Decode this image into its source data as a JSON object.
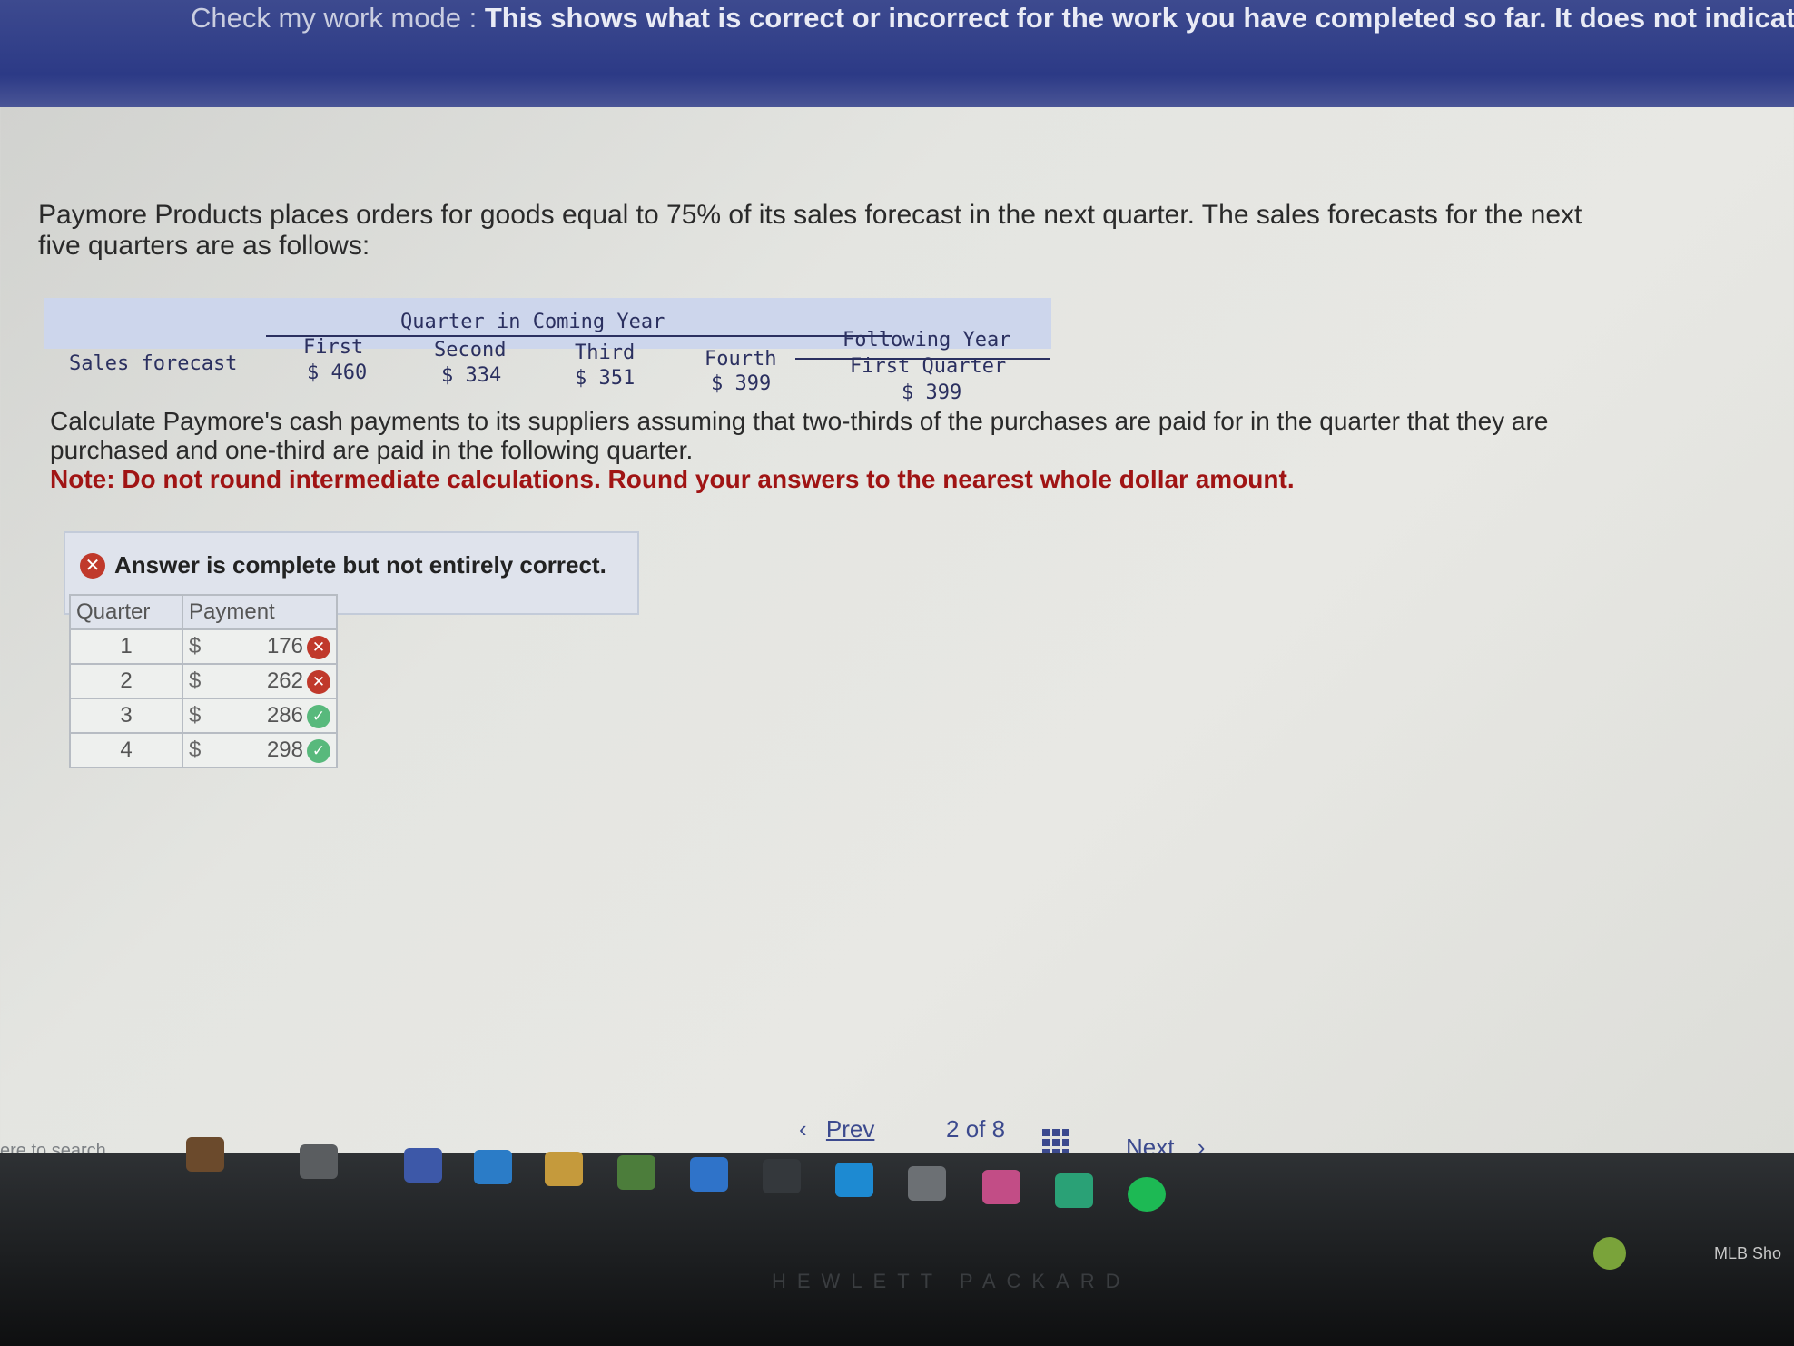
{
  "banner": {
    "lead": "Check my work mode : ",
    "text": "This shows what is correct or incorrect for the work you have completed so far. It does not indicate com"
  },
  "intro": "Paymore Products places orders for goods equal to 75% of its sales forecast in the next quarter. The sales forecasts for the next five quarters are as follows:",
  "forecast_table": {
    "group_coming": "Quarter in Coming Year",
    "group_following": "Following Year",
    "row_label": "Sales forecast",
    "columns": [
      {
        "header": "First",
        "value": "$ 460"
      },
      {
        "header": "Second",
        "value": "$ 334"
      },
      {
        "header": "Third",
        "value": "$ 351"
      },
      {
        "header": "Fourth",
        "value": "$ 399"
      },
      {
        "header": "First Quarter",
        "value": "$ 399"
      }
    ]
  },
  "question": "Calculate Paymore's cash payments to its suppliers assuming that two-thirds of the purchases are paid for in the quarter that they are purchased and one-third are paid in the following quarter.",
  "note": "Note: Do not round intermediate calculations. Round your answers to the nearest whole dollar amount.",
  "result": {
    "message": "Answer is complete but not entirely correct.",
    "status_icon": "x-circle-icon",
    "color": "#c0392b"
  },
  "answer_table": {
    "headers": [
      "Quarter",
      "Payment"
    ],
    "currency": "$",
    "rows": [
      {
        "quarter": "1",
        "payment": "176",
        "correct": false
      },
      {
        "quarter": "2",
        "payment": "262",
        "correct": false
      },
      {
        "quarter": "3",
        "payment": "286",
        "correct": true
      },
      {
        "quarter": "4",
        "payment": "298",
        "correct": true
      }
    ],
    "colors": {
      "incorrect": "#c0392b",
      "correct": "#58b97c"
    }
  },
  "navigation": {
    "prev": "Prev",
    "page": "2",
    "of": "of",
    "total": "8",
    "next": "Next"
  },
  "taskbar": {
    "search_hint": "ere to search",
    "tray_label": "MLB Sho",
    "brand": "HEWLETT PACKARD"
  },
  "theme": {
    "banner": "#2c3a86",
    "accent": "#3c4a8e",
    "note": "#a01414"
  }
}
